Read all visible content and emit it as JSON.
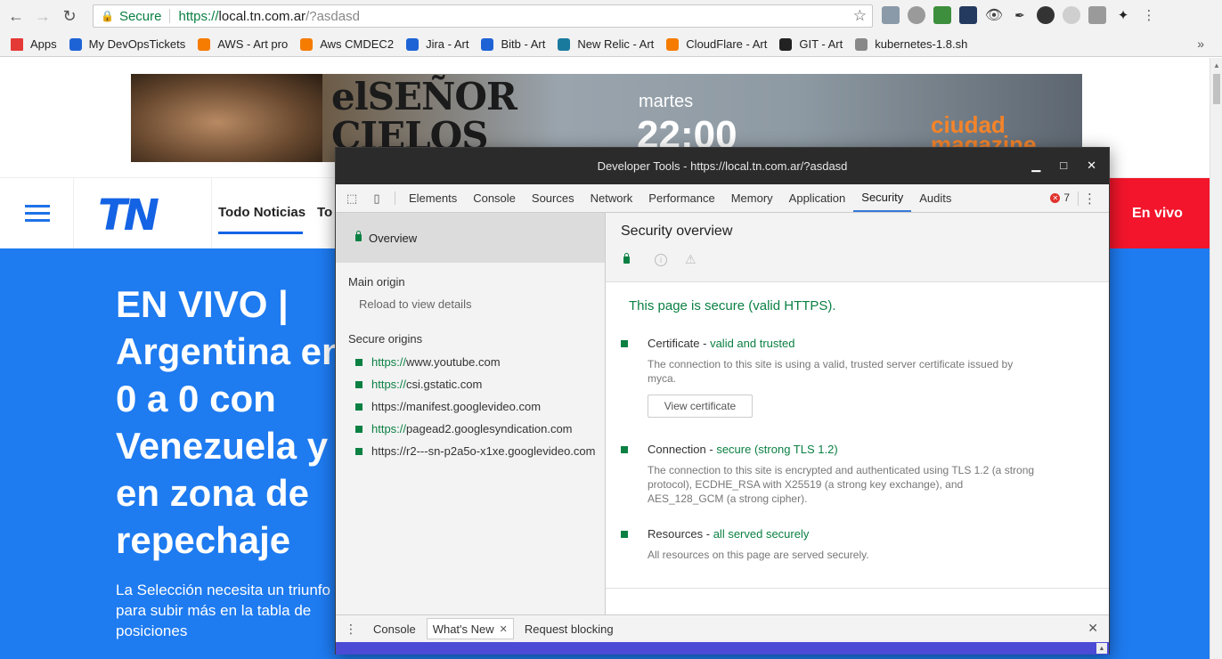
{
  "browser": {
    "secure_label": "Secure",
    "url_scheme": "https://",
    "url_host": "local.tn.com.ar",
    "url_path": "/?asdasd"
  },
  "bookmarks": [
    {
      "label": "Apps",
      "color": "#e53935"
    },
    {
      "label": "My DevOpsTickets",
      "color": "#1e63d6"
    },
    {
      "label": "AWS - Art pro",
      "color": "#f57c00"
    },
    {
      "label": "Aws CMDEC2",
      "color": "#f57c00"
    },
    {
      "label": "Jira - Art",
      "color": "#1e63d6"
    },
    {
      "label": "Bitb - Art",
      "color": "#1e63d6"
    },
    {
      "label": "New Relic - Art",
      "color": "#1a7a9e"
    },
    {
      "label": "CloudFlare - Art",
      "color": "#f57c00"
    },
    {
      "label": "GIT - Art",
      "color": "#222222"
    },
    {
      "label": "kubernetes-1.8.sh",
      "color": "#888888"
    }
  ],
  "banner": {
    "title": "elSEÑOR\nCIELOS",
    "subtitle": "martes",
    "time": "22:00",
    "brand": "ciudad\nmagazine"
  },
  "site": {
    "logo": "TN",
    "nav_item_1": "Todo Noticias",
    "nav_item_2": "To",
    "live_button": "En vivo",
    "hero_title": "EN VIVO | Argentina en 0 a 0 con Venezuela y en zona de repechaje",
    "hero_sub": "La Selección necesita un triunfo para subir más en la tabla de posiciones"
  },
  "devtools": {
    "window_title": "Developer Tools - https://local.tn.com.ar/?asdasd",
    "tabs": [
      "Elements",
      "Console",
      "Sources",
      "Network",
      "Performance",
      "Memory",
      "Application",
      "Security",
      "Audits"
    ],
    "active_tab": "Security",
    "error_count": "7",
    "sidebar": {
      "overview": "Overview",
      "main_origin_heading": "Main origin",
      "main_origin_detail": "Reload to view details",
      "secure_origins_heading": "Secure origins",
      "origins": [
        {
          "scheme": "https://",
          "host": "www.youtube.com",
          "scheme_green": true
        },
        {
          "scheme": "https://",
          "host": "csi.gstatic.com",
          "scheme_green": true
        },
        {
          "scheme": "https://",
          "host": "manifest.googlevideo.com",
          "scheme_green": false
        },
        {
          "scheme": "https://",
          "host": "pagead2.googlesyndication.com",
          "scheme_green": true
        },
        {
          "scheme": "https://",
          "host": "r2---sn-p2a5o-x1xe.googlevideo.com",
          "scheme_green": false
        }
      ]
    },
    "overview": {
      "title": "Security overview",
      "summary": "This page is secure (valid HTTPS).",
      "certificate_label": "Certificate - ",
      "certificate_status": "valid and trusted",
      "certificate_desc": "The connection to this site is using a valid, trusted server certificate issued by myca.",
      "view_certificate": "View certificate",
      "connection_label": "Connection - ",
      "connection_status": "secure (strong TLS 1.2)",
      "connection_desc": "The connection to this site is encrypted and authenticated using TLS 1.2 (a strong protocol), ECDHE_RSA with X25519 (a strong key exchange), and AES_128_GCM (a strong cipher).",
      "resources_label": "Resources - ",
      "resources_status": "all served securely",
      "resources_desc": "All resources on this page are served securely."
    },
    "drawer": {
      "tabs": [
        "Console",
        "What's New",
        "Request blocking"
      ],
      "active": "What's New"
    }
  }
}
